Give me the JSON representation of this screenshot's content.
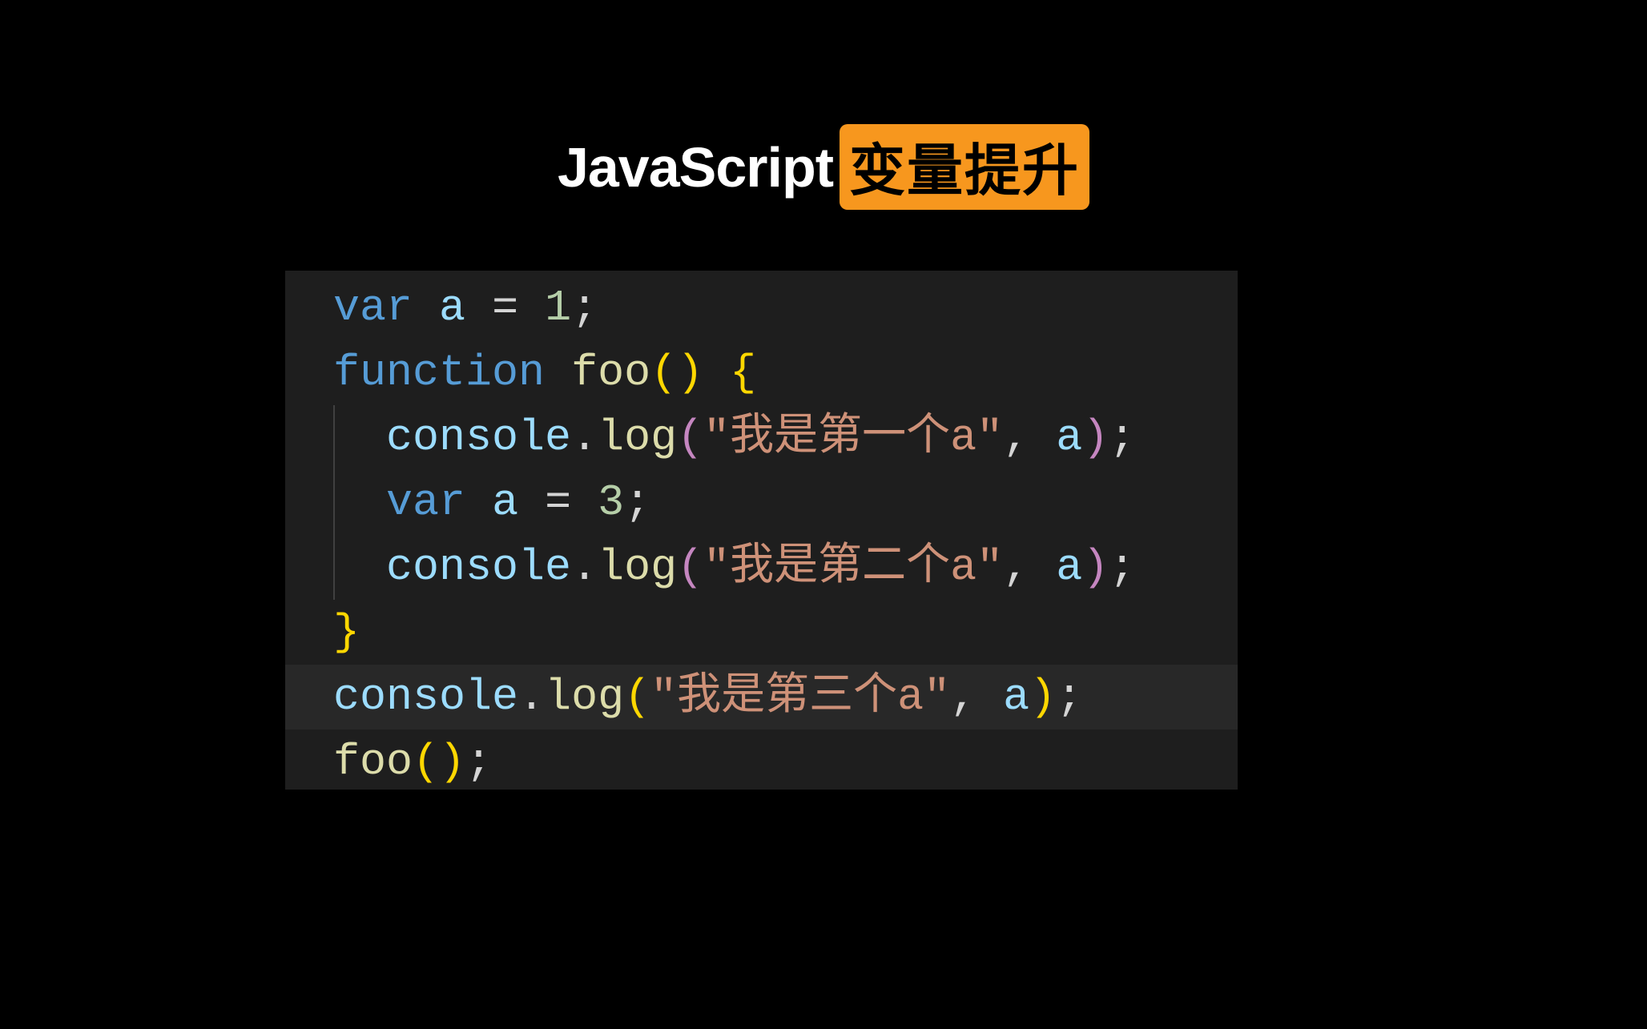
{
  "title": {
    "plain": "JavaScript",
    "badge": "变量提升"
  },
  "code": {
    "line1": {
      "kw": "var",
      "sp1": " ",
      "var": "a",
      "sp2": " ",
      "op": "=",
      "sp3": " ",
      "num": "1",
      "semi": ";"
    },
    "line2": {
      "kw": "function",
      "sp1": " ",
      "name": "foo",
      "paren": "()",
      "sp2": " ",
      "brace": "{"
    },
    "line3": {
      "indent": "  ",
      "obj": "console",
      "dot": ".",
      "method": "log",
      "lp": "(",
      "str": "\"我是第一个a\"",
      "comma": ",",
      "sp": " ",
      "arg": "a",
      "rp": ")",
      "semi": ";"
    },
    "line4": {
      "indent": "  ",
      "kw": "var",
      "sp1": " ",
      "var": "a",
      "sp2": " ",
      "op": "=",
      "sp3": " ",
      "num": "3",
      "semi": ";"
    },
    "line5": {
      "indent": "  ",
      "obj": "console",
      "dot": ".",
      "method": "log",
      "lp": "(",
      "str": "\"我是第二个a\"",
      "comma": ",",
      "sp": " ",
      "arg": "a",
      "rp": ")",
      "semi": ";"
    },
    "line6": {
      "brace": "}"
    },
    "line7": {
      "obj": "console",
      "dot": ".",
      "method": "log",
      "lp": "(",
      "str": "\"我是第三个a\"",
      "comma": ",",
      "sp": " ",
      "arg": "a",
      "rp": ")",
      "semi": ";"
    },
    "line8": {
      "name": "foo",
      "paren": "()",
      "semi": ";"
    }
  }
}
